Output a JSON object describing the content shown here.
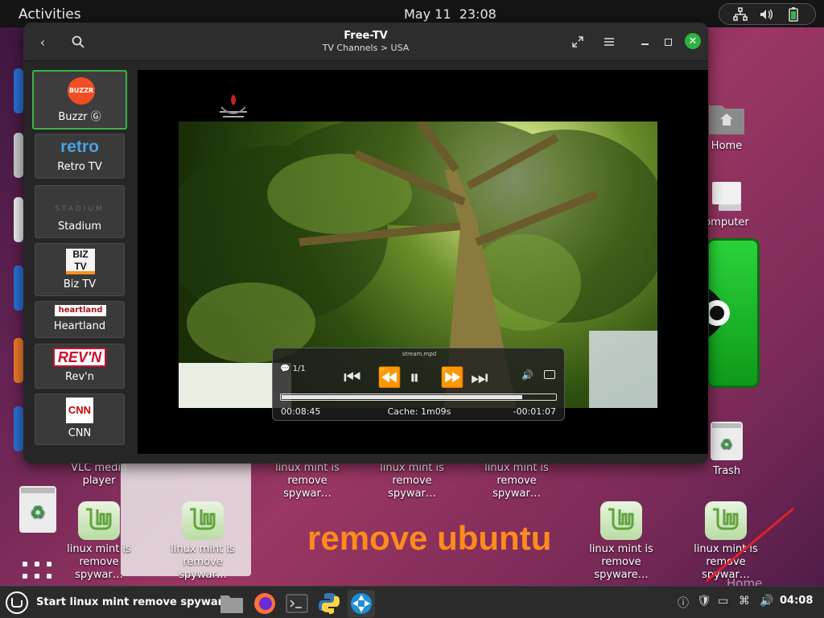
{
  "topbar": {
    "activities": "Activities",
    "clock": "May 11  23:08"
  },
  "window": {
    "title": "Free-TV",
    "subtitle": "TV Channels > USA",
    "channels": [
      {
        "label": "Buzzr Ⓖ",
        "logo": "BUZZR"
      },
      {
        "label": "Retro TV",
        "logo": "retro"
      },
      {
        "label": "Stadium",
        "logo": "STADIUM"
      },
      {
        "label": "Biz TV",
        "logo": "BIZ TV"
      },
      {
        "label": "Heartland",
        "logo": "heartland"
      },
      {
        "label": "Rev'n",
        "logo": "REV'N"
      },
      {
        "label": "CNN",
        "logo": "CNN"
      }
    ]
  },
  "player": {
    "filename": "stream.mpd",
    "chapter": "1/1",
    "elapsed": "00:08:45",
    "cache": "Cache: 1m09s",
    "remaining": "-00:01:07",
    "progress": 0.88
  },
  "desktop": {
    "icons": {
      "home": "Home",
      "computer": "omputer",
      "trash": "Trash",
      "vlc": "VLC media player",
      "mint_line1": "linux mint is",
      "mint_line2": "remove spywar…",
      "mint_line2b": "remove spyware…"
    },
    "banner": "remove ubuntu",
    "home_faded": "Home"
  },
  "taskbar": {
    "start_label": "Start linux mint remove spyware",
    "time": "04:08"
  }
}
